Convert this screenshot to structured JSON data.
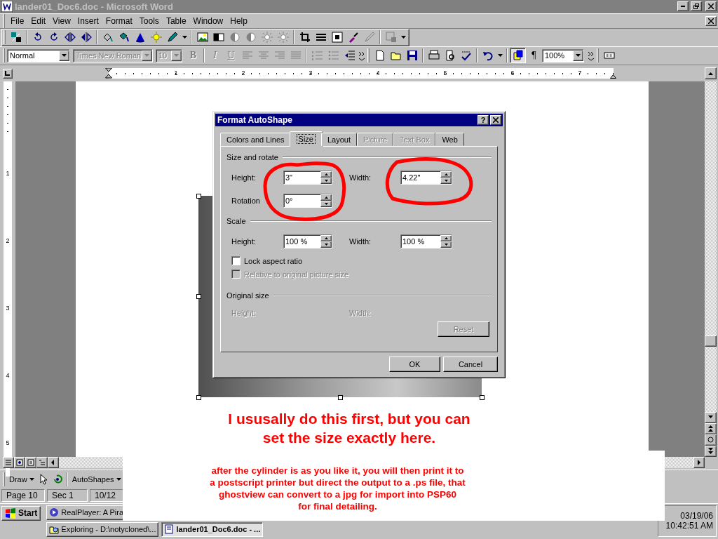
{
  "window": {
    "title": "lander01_Doc6.doc - Microsoft Word"
  },
  "menu": [
    "File",
    "Edit",
    "View",
    "Insert",
    "Format",
    "Tools",
    "Table",
    "Window",
    "Help"
  ],
  "formatting": {
    "style": "Normal",
    "font": {
      "value": "Times New Roman",
      "disabled": true
    },
    "size": {
      "value": "10",
      "disabled": true
    },
    "text_buttons": [
      {
        "label": "B",
        "kind": "bold",
        "disabled": true
      },
      {
        "label": "I",
        "kind": "italic",
        "disabled": true
      },
      {
        "label": "U",
        "kind": "underline",
        "disabled": true
      }
    ],
    "paragraph_mark": "¶",
    "zoom": "100%"
  },
  "ruler": {
    "horizontal": [
      "1",
      "2",
      "3",
      "4",
      "5",
      "6",
      "7"
    ],
    "vertical": [
      "1",
      "2",
      "3",
      "4",
      "5"
    ]
  },
  "document": {
    "note": "I ususally do this first, but you can\nset the size exactly here."
  },
  "dialog": {
    "title": "Format AutoShape",
    "help": "?",
    "tabs": [
      {
        "label": "Colors and Lines",
        "selected": false,
        "disabled": false
      },
      {
        "label": "Size",
        "selected": true,
        "disabled": false
      },
      {
        "label": "Layout",
        "selected": false,
        "disabled": false
      },
      {
        "label": "Picture",
        "selected": false,
        "disabled": true
      },
      {
        "label": "Text Box",
        "selected": false,
        "disabled": true
      },
      {
        "label": "Web",
        "selected": false,
        "disabled": false
      }
    ],
    "size_and_rotate": {
      "title": "Size and rotate",
      "height": {
        "label": "Height:",
        "value": "3\""
      },
      "width": {
        "label": "Width:",
        "value": "4.22\""
      },
      "rotation": {
        "label": "Rotation",
        "value": "0°"
      }
    },
    "scale": {
      "title": "Scale",
      "height": {
        "label": "Height:",
        "value": "100 %"
      },
      "width": {
        "label": "Width:",
        "value": "100 %"
      },
      "checkboxes": [
        {
          "label": "Lock aspect ratio",
          "checked": false,
          "disabled": false
        },
        {
          "label": "Relative to original picture size",
          "checked": false,
          "disabled": true
        }
      ]
    },
    "original_size": {
      "title": "Original size",
      "height": {
        "label": "Height:",
        "disabled": true
      },
      "width": {
        "label": "Width:",
        "disabled": true
      },
      "reset": {
        "label": "Reset",
        "disabled": true
      }
    },
    "buttons": [
      "OK",
      "Cancel"
    ]
  },
  "overlay_note": "after the cylinder is as you like it, you will then print it to\na postscript printer but direct the output to a .ps file, that\nghostview can convert to a jpg for import into PSP60\nfor final detailing.",
  "drawing_toolbar": {
    "draw": "Draw",
    "autoshapes": "AutoShapes"
  },
  "status_bar": [
    "Page 10",
    "Sec 1",
    "10/12"
  ],
  "taskbar": {
    "start": "Start",
    "tasks": [
      {
        "label": "RealPlayer: A Pira",
        "selected": false
      },
      {
        "label": "Exploring - D:\\notycloned\\...",
        "selected": false
      },
      {
        "label": "lander01_Doc6.doc - ...",
        "selected": true
      }
    ],
    "date": "03/19/06",
    "time": "10:42:51 AM"
  }
}
